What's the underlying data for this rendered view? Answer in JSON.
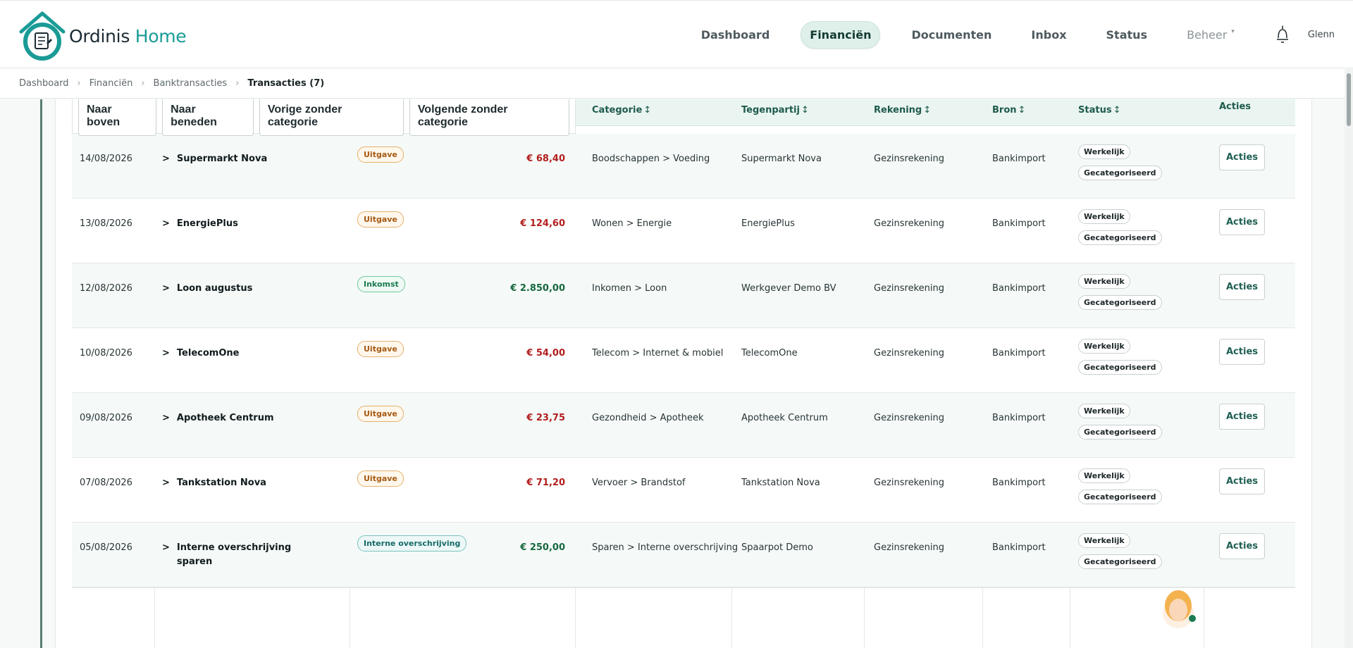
{
  "brand": {
    "name_main": "Ordinis",
    "name_accent": "Home"
  },
  "nav": {
    "items": [
      "Dashboard",
      "Financiën",
      "Documenten",
      "Inbox",
      "Status"
    ],
    "active": "Financiën",
    "admin": "Beheer",
    "user": "Glenn"
  },
  "breadcrumb": [
    "Dashboard",
    "Financiën",
    "Banktransacties",
    "Transacties (7)"
  ],
  "jump": {
    "top": "Naar boven",
    "down": "Naar beneden",
    "prev": "Vorige zonder categorie",
    "next": "Volgende zonder categorie"
  },
  "columns": {
    "category": "Categorie",
    "counterparty": "Tegenpartij",
    "account": "Rekening",
    "source": "Bron",
    "status": "Status",
    "actions": "Acties",
    "sort_icon": "↕"
  },
  "rows": [
    {
      "date": "14/08/2026",
      "desc": "Supermarkt Nova",
      "type": "Uitgave",
      "amount": "€ 68,40",
      "category": "Boodschappen > Voeding",
      "counterparty": "Supermarkt Nova",
      "account": "Gezinsrekening",
      "source": "Bankimport",
      "status1": "Werkelijk",
      "status2": "Gecategoriseerd",
      "action": "Acties"
    },
    {
      "date": "13/08/2026",
      "desc": "EnergiePlus",
      "type": "Uitgave",
      "amount": "€ 124,60",
      "category": "Wonen > Energie",
      "counterparty": "EnergiePlus",
      "account": "Gezinsrekening",
      "source": "Bankimport",
      "status1": "Werkelijk",
      "status2": "Gecategoriseerd",
      "action": "Acties"
    },
    {
      "date": "12/08/2026",
      "desc": "Loon augustus",
      "type": "Inkomst",
      "amount": "€ 2.850,00",
      "category": "Inkomen > Loon",
      "counterparty": "Werkgever Demo BV",
      "account": "Gezinsrekening",
      "source": "Bankimport",
      "status1": "Werkelijk",
      "status2": "Gecategoriseerd",
      "action": "Acties"
    },
    {
      "date": "10/08/2026",
      "desc": "TelecomOne",
      "type": "Uitgave",
      "amount": "€ 54,00",
      "category": "Telecom > Internet & mobiel",
      "counterparty": "TelecomOne",
      "account": "Gezinsrekening",
      "source": "Bankimport",
      "status1": "Werkelijk",
      "status2": "Gecategoriseerd",
      "action": "Acties"
    },
    {
      "date": "09/08/2026",
      "desc": "Apotheek Centrum",
      "type": "Uitgave",
      "amount": "€ 23,75",
      "category": "Gezondheid > Apotheek",
      "counterparty": "Apotheek Centrum",
      "account": "Gezinsrekening",
      "source": "Bankimport",
      "status1": "Werkelijk",
      "status2": "Gecategoriseerd",
      "action": "Acties"
    },
    {
      "date": "07/08/2026",
      "desc": "Tankstation Nova",
      "type": "Uitgave",
      "amount": "€ 71,20",
      "category": "Vervoer > Brandstof",
      "counterparty": "Tankstation Nova",
      "account": "Gezinsrekening",
      "source": "Bankimport",
      "status1": "Werkelijk",
      "status2": "Gecategoriseerd",
      "action": "Acties"
    },
    {
      "date": "05/08/2026",
      "desc": "Interne overschrijving",
      "desc2": "sparen",
      "type": "Interne overschrijving",
      "amount": "€ 250,00",
      "category": "Sparen > Interne overschrijving",
      "counterparty": "Spaarpot Demo",
      "account": "Gezinsrekening",
      "source": "Bankimport",
      "status1": "Werkelijk",
      "status2": "Gecategoriseerd",
      "action": "Acties"
    }
  ],
  "colors": {
    "accent": "#1a9b96",
    "expense": "#b21e1e",
    "income": "#17683f",
    "header_bg": "#eaf5f1"
  }
}
